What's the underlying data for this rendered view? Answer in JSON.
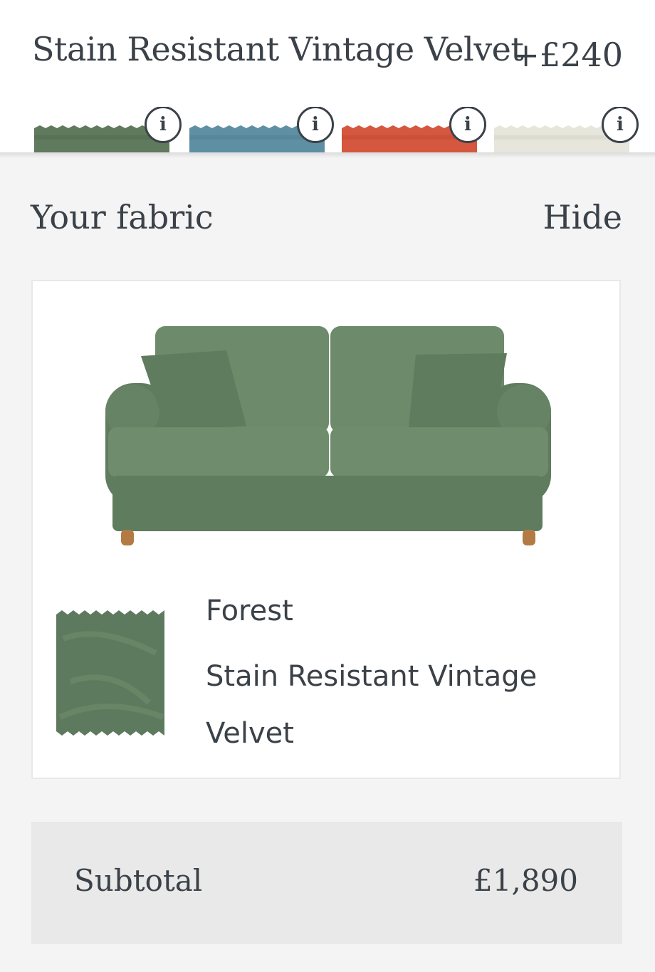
{
  "header": {
    "fabric_title": "Stain Resistant Vintage Velvet",
    "price_delta": "+£240"
  },
  "swatches": [
    {
      "name": "forest",
      "color": "#5f7a5c",
      "info_icon": "info-icon"
    },
    {
      "name": "teal-blue",
      "color": "#5f8fa3",
      "info_icon": "info-icon"
    },
    {
      "name": "burnt-orange",
      "color": "#d5573f",
      "info_icon": "info-icon"
    },
    {
      "name": "ivory",
      "color": "#e6e6dc",
      "info_icon": "info-icon"
    }
  ],
  "panel": {
    "title": "Your fabric",
    "hide_label": "Hide"
  },
  "selected": {
    "color_name": "Forest",
    "fabric_name": "Stain Resistant Vintage Velvet",
    "color": "#5e7a5e"
  },
  "summary": {
    "subtotal_label": "Subtotal",
    "subtotal_value": "£1,890"
  }
}
